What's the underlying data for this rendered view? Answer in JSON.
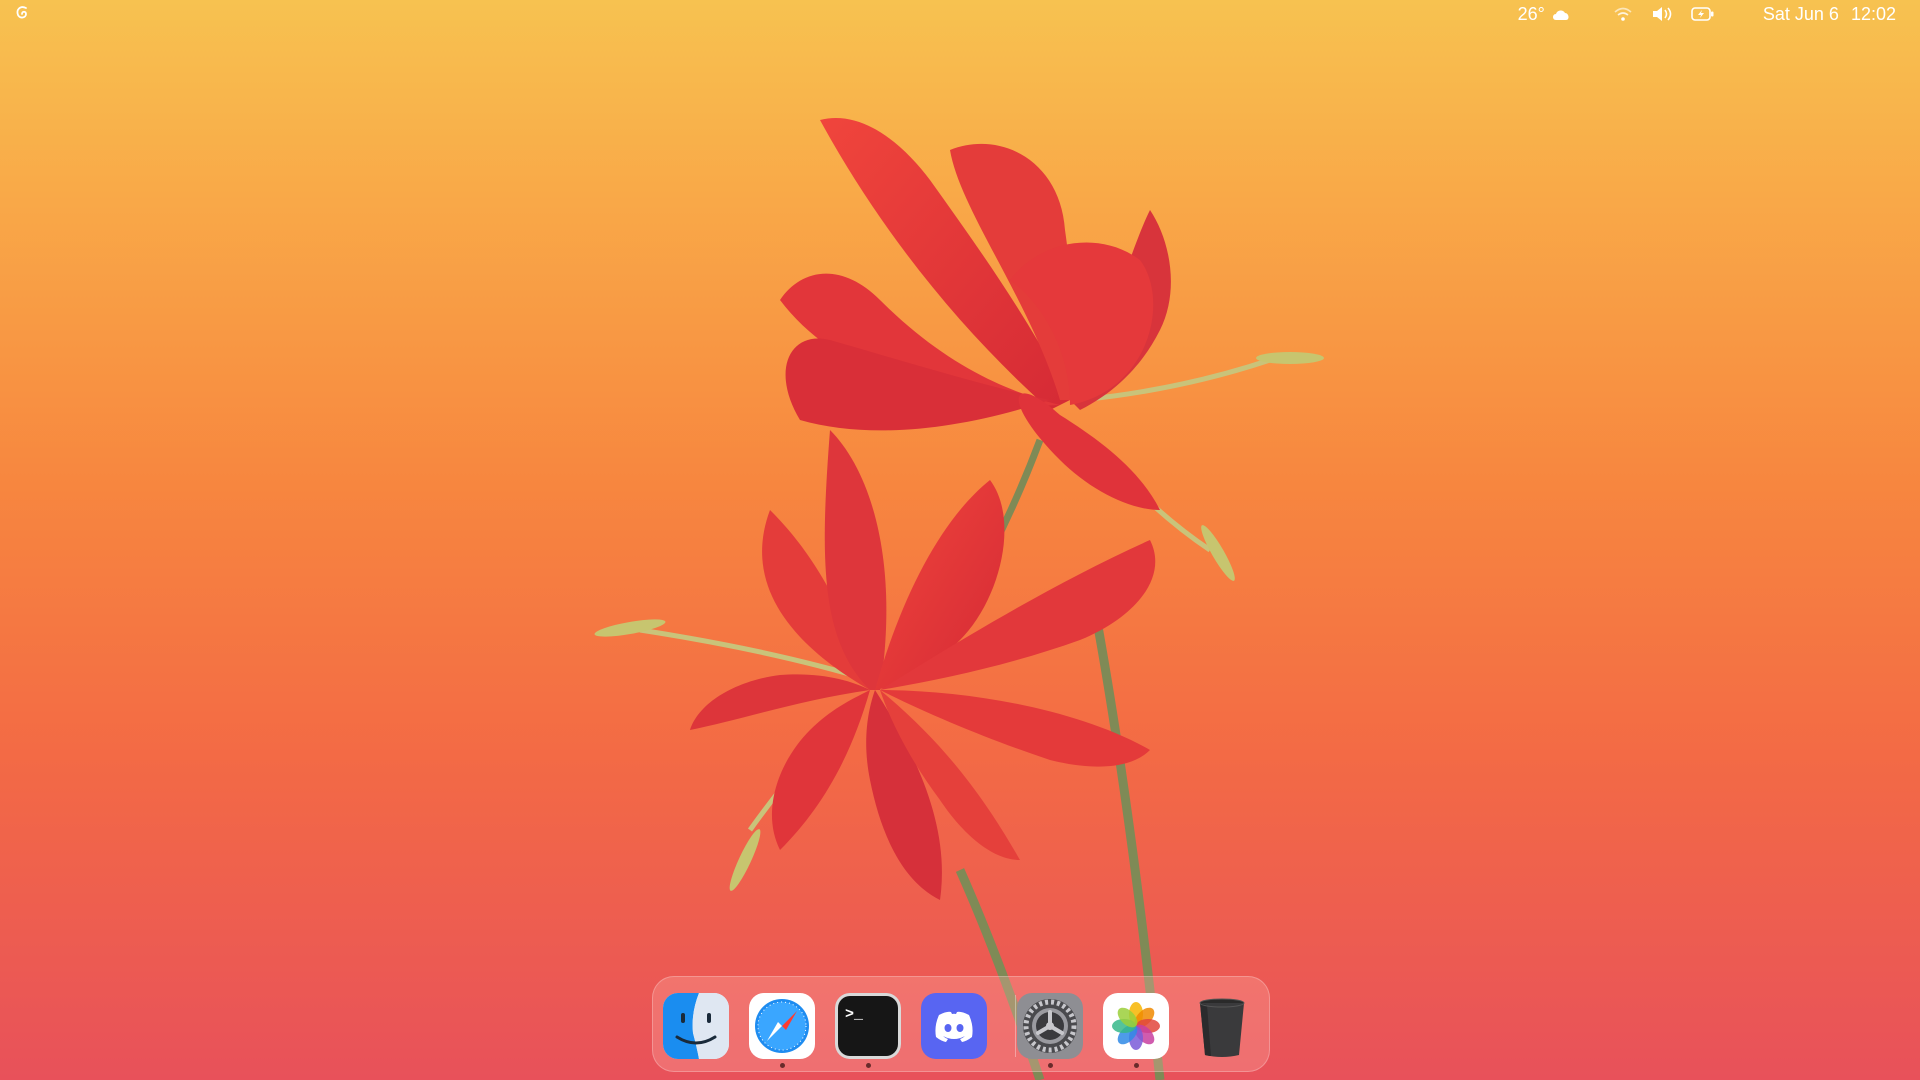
{
  "menubar": {
    "logo_icon": "debian-swirl-icon",
    "weather_temp": "26°",
    "weather_icon": "cloud-icon",
    "wifi_icon": "wifi-icon",
    "volume_icon": "volume-icon",
    "battery_icon": "battery-charging-icon",
    "date": "Sat Jun 6",
    "time": "12:02"
  },
  "dock": {
    "apps": [
      {
        "name": "Finder",
        "icon": "finder-icon",
        "running": false
      },
      {
        "name": "Safari",
        "icon": "safari-icon",
        "running": true
      },
      {
        "name": "Terminal",
        "icon": "terminal-icon",
        "running": true,
        "glyph": ">_"
      },
      {
        "name": "Discord",
        "icon": "discord-icon",
        "running": false
      },
      {
        "name": "System Preferences",
        "icon": "settings-gear-icon",
        "running": true
      },
      {
        "name": "Photos",
        "icon": "photos-icon",
        "running": true
      },
      {
        "name": "Trash",
        "icon": "trash-icon",
        "running": false
      }
    ]
  },
  "colors": {
    "wallpaper_top": "#f7c250",
    "wallpaper_bottom": "#e8515a",
    "petal": "#e8363a",
    "stem": "#a8a96a"
  }
}
